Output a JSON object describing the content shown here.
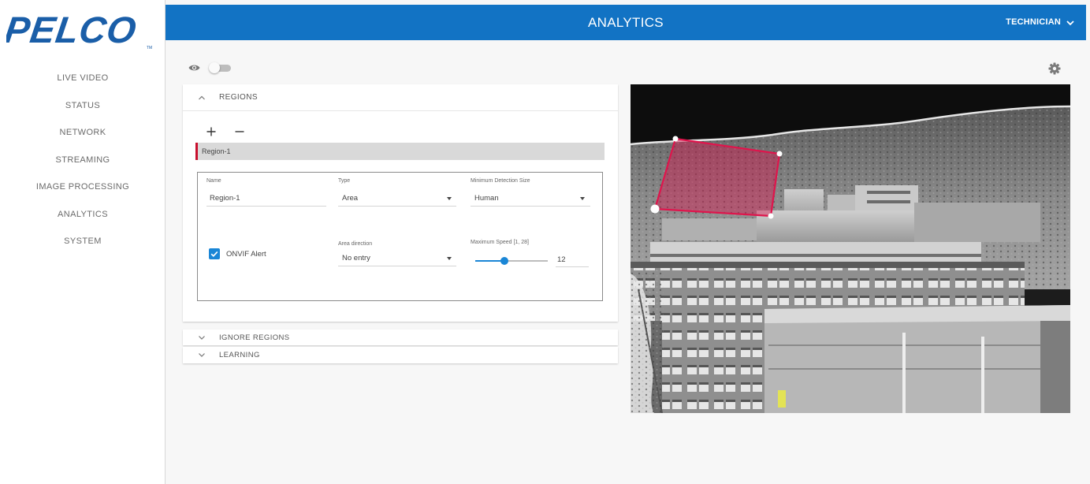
{
  "brand": {
    "logo_text": "PELCO",
    "trademark": "TM"
  },
  "header": {
    "title": "ANALYTICS",
    "user_label": "TECHNICIAN"
  },
  "sidebar": {
    "items": [
      {
        "label": "LIVE VIDEO"
      },
      {
        "label": "STATUS"
      },
      {
        "label": "NETWORK"
      },
      {
        "label": "STREAMING"
      },
      {
        "label": "IMAGE PROCESSING"
      },
      {
        "label": "ANALYTICS"
      },
      {
        "label": "SYSTEM"
      }
    ]
  },
  "overlay_toggle": {
    "on": false
  },
  "sections": {
    "regions": {
      "title": "REGIONS",
      "expanded": true
    },
    "ignore_regions": {
      "title": "IGNORE REGIONS",
      "expanded": false
    },
    "learning": {
      "title": "LEARNING",
      "expanded": false
    }
  },
  "region_list": [
    {
      "name": "Region-1",
      "selected": true
    }
  ],
  "region_form": {
    "name_label": "Name",
    "name_value": "Region-1",
    "type_label": "Type",
    "type_value": "Area",
    "min_size_label": "Minimum Detection Size",
    "min_size_value": "Human",
    "onvif_label": "ONVIF Alert",
    "onvif_checked": true,
    "direction_label": "Area direction",
    "direction_value": "No entry",
    "speed_label": "Maximum Speed [1, 28]",
    "speed_value": "12",
    "speed_min": 1,
    "speed_max": 28
  },
  "colors": {
    "topbar": "#1273c4",
    "brand_blue": "#1a5ea8",
    "accent": "#1a86d6",
    "region_outline": "#e0144c",
    "region_fill": "#d8194f"
  }
}
